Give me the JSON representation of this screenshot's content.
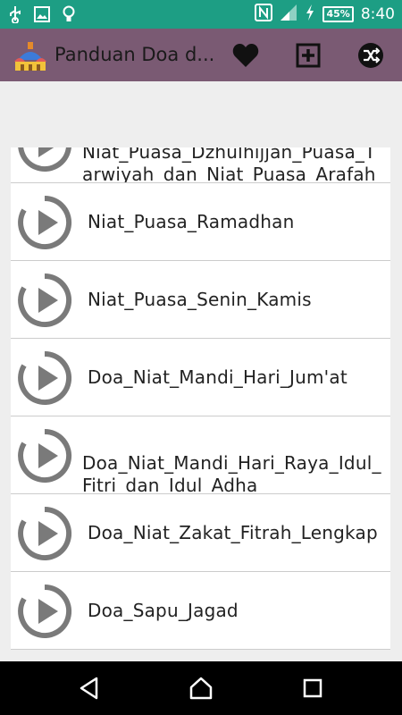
{
  "status_bar": {
    "battery": "45%",
    "time": "8:40"
  },
  "app_bar": {
    "title": "Panduan Doa d..."
  },
  "list": {
    "items": [
      {
        "label": "Niat_Puasa_Dzhulhijjan_Puasa_Tarwiyah_dan_Niat_Puasa_Arafah"
      },
      {
        "label": "Niat_Puasa_Ramadhan"
      },
      {
        "label": "Niat_Puasa_Senin_Kamis"
      },
      {
        "label": "Doa_Niat_Mandi_Hari_Jum'at"
      },
      {
        "label": "Doa_Niat_Mandi_Hari_Raya_Idul_Fitri_dan_Idul_Adha"
      },
      {
        "label": "Doa_Niat_Zakat_Fitrah_Lengkap"
      },
      {
        "label": "Doa_Sapu_Jagad"
      }
    ]
  },
  "colors": {
    "status_bar": "#1d9e84",
    "app_bar": "#7a5a73",
    "list_background": "#eeeeee",
    "play_icon": "#7a7a7a"
  },
  "icons": {
    "favorite": "heart-icon",
    "add": "add-box-icon",
    "share": "shuffle-icon",
    "item": "play-icon"
  }
}
